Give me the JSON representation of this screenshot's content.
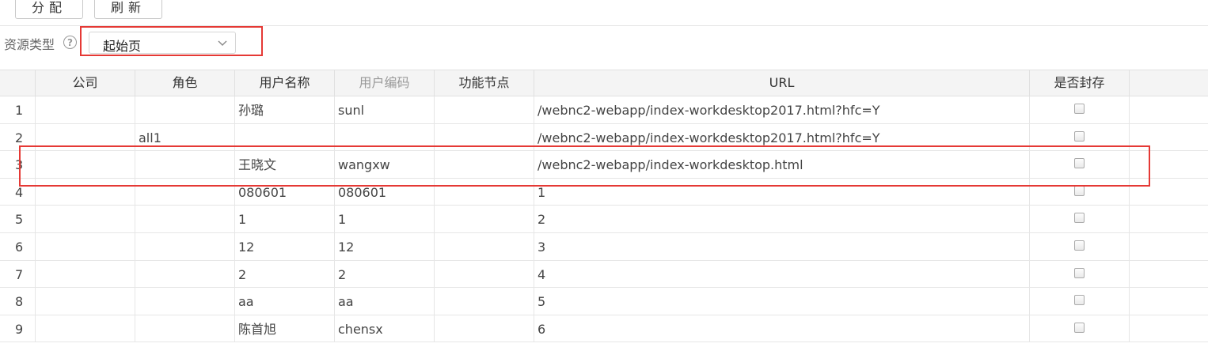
{
  "toolbar": {
    "assign_label": "分配",
    "refresh_label": "刷新"
  },
  "filter": {
    "label": "资源类型",
    "help_symbol": "?",
    "selected": "起始页"
  },
  "table": {
    "headers": [
      "",
      "公司",
      "角色",
      "用户名称",
      "用户编码",
      "功能节点",
      "URL",
      "是否封存"
    ],
    "rows": [
      {
        "idx": "1",
        "company": "",
        "role": "",
        "user_name": "孙璐",
        "user_code": "sunl",
        "node": "",
        "url": "/webnc2-webapp/index-workdesktop2017.html?hfc=Y",
        "sealed": false
      },
      {
        "idx": "2",
        "company": "",
        "role": "all1",
        "user_name": "",
        "user_code": "",
        "node": "",
        "url": "/webnc2-webapp/index-workdesktop2017.html?hfc=Y",
        "sealed": false
      },
      {
        "idx": "3",
        "company": "",
        "role": "",
        "user_name": "王晓文",
        "user_code": "wangxw",
        "node": "",
        "url": "/webnc2-webapp/index-workdesktop.html",
        "sealed": false
      },
      {
        "idx": "4",
        "company": "",
        "role": "",
        "user_name": "080601",
        "user_code": "080601",
        "node": "",
        "url": "1",
        "sealed": false
      },
      {
        "idx": "5",
        "company": "",
        "role": "",
        "user_name": "1",
        "user_code": "1",
        "node": "",
        "url": "2",
        "sealed": false
      },
      {
        "idx": "6",
        "company": "",
        "role": "",
        "user_name": "12",
        "user_code": "12",
        "node": "",
        "url": "3",
        "sealed": false
      },
      {
        "idx": "7",
        "company": "",
        "role": "",
        "user_name": "2",
        "user_code": "2",
        "node": "",
        "url": "4",
        "sealed": false
      },
      {
        "idx": "8",
        "company": "",
        "role": "",
        "user_name": "aa",
        "user_code": "aa",
        "node": "",
        "url": "5",
        "sealed": false
      },
      {
        "idx": "9",
        "company": "",
        "role": "",
        "user_name": "陈首旭",
        "user_code": "chensx",
        "node": "",
        "url": "6",
        "sealed": false
      }
    ]
  },
  "colors": {
    "highlight": "#e53935",
    "header_bg": "#f4f4f4",
    "grid_line": "#e6e6e6"
  }
}
